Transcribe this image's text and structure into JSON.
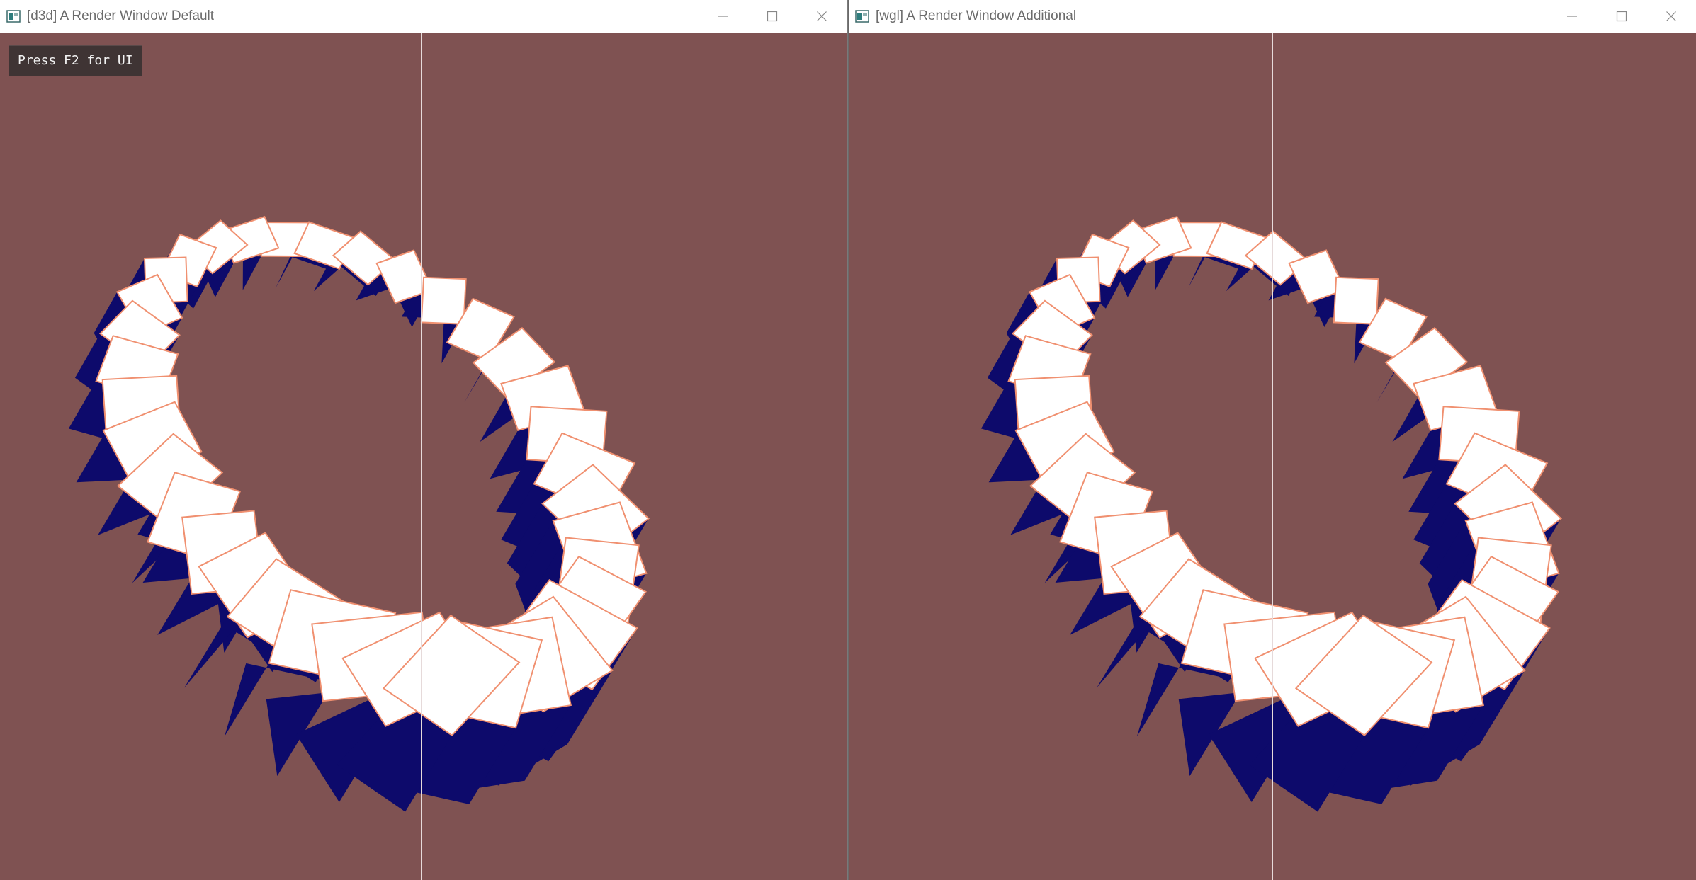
{
  "windows": [
    {
      "title": "[d3d] A Render Window Default",
      "controls": {
        "minimize": "minimize-icon",
        "maximize": "maximize-icon",
        "close": "close-icon"
      },
      "overlay_hint": "Press F2 for UI"
    },
    {
      "title": "[wgl] A Render Window Additional",
      "controls": {
        "minimize": "minimize-icon",
        "maximize": "maximize-icon",
        "close": "close-icon"
      }
    }
  ],
  "colors": {
    "clear_color": "#7f5252",
    "cube_face_lit": "#ffffff",
    "cube_face_shadow": "#0d0a6b",
    "cube_edge_highlight": "#f09070",
    "divider_line": "#e6dada"
  },
  "scene": {
    "object": "ring of rotating cubes",
    "cube_count": 36
  }
}
